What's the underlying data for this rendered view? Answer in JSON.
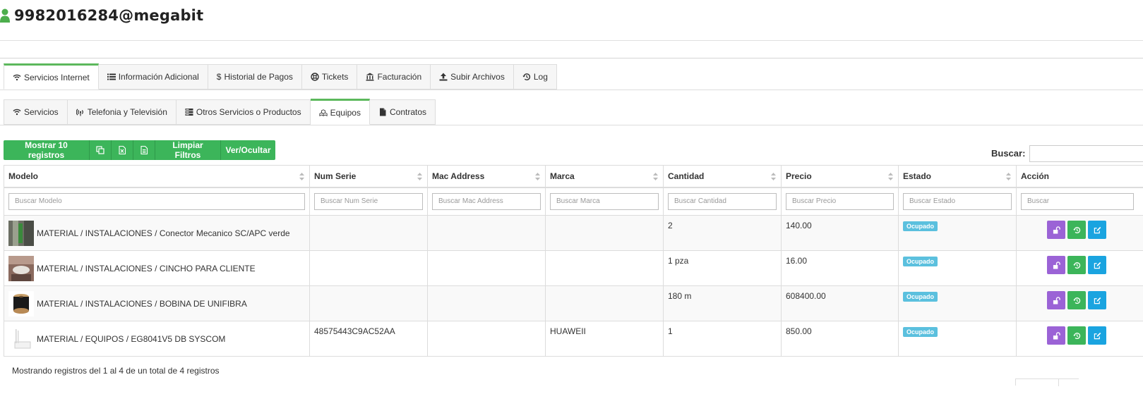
{
  "header": {
    "title": "9982016284@megabit"
  },
  "main_tabs": [
    {
      "label": "Servicios Internet",
      "icon": "wifi-icon",
      "active": true
    },
    {
      "label": "Información Adicional",
      "icon": "list-icon"
    },
    {
      "label": "Historial de Pagos",
      "icon": "dollar-icon"
    },
    {
      "label": "Tickets",
      "icon": "lifebuoy-icon"
    },
    {
      "label": "Facturación",
      "icon": "bank-icon"
    },
    {
      "label": "Subir Archivos",
      "icon": "upload-icon"
    },
    {
      "label": "Log",
      "icon": "history-icon"
    }
  ],
  "sub_tabs": [
    {
      "label": "Servicios",
      "icon": "wifi-icon"
    },
    {
      "label": "Telefonia y Televisión",
      "icon": "broadcast-icon"
    },
    {
      "label": "Otros Servicios o Productos",
      "icon": "server-icon"
    },
    {
      "label": "Equipos",
      "icon": "cubes-icon",
      "active": true
    },
    {
      "label": "Contratos",
      "icon": "file-icon"
    }
  ],
  "toolbar": {
    "show_label": "Mostrar 10 registros",
    "clear_filters_label": "Limpiar Filtros",
    "toggle_columns_label": "Ver/Ocultar"
  },
  "search": {
    "label": "Buscar:",
    "value": ""
  },
  "table": {
    "columns": [
      "Modelo",
      "Num Serie",
      "Mac Address",
      "Marca",
      "Cantidad",
      "Precio",
      "Estado",
      "Acción"
    ],
    "filter_placeholders": [
      "Buscar Modelo",
      "Buscar Num Serie",
      "Buscar Mac Address",
      "Buscar Marca",
      "Buscar Cantidad",
      "Buscar Precio",
      "Buscar Estado",
      "Buscar"
    ],
    "rows": [
      {
        "modelo": "MATERIAL / INSTALACIONES / Conector Mecanico SC/APC verde",
        "num_serie": "",
        "mac": "",
        "marca": "",
        "cantidad": "2",
        "precio": "140.00",
        "estado": "Ocupado"
      },
      {
        "modelo": "MATERIAL / INSTALACIONES / CINCHO PARA CLIENTE",
        "num_serie": "",
        "mac": "",
        "marca": "",
        "cantidad": "1 pza",
        "precio": "16.00",
        "estado": "Ocupado"
      },
      {
        "modelo": "MATERIAL / INSTALACIONES / BOBINA DE UNIFIBRA",
        "num_serie": "",
        "mac": "",
        "marca": "",
        "cantidad": "180 m",
        "precio": "608400.00",
        "estado": "Ocupado"
      },
      {
        "modelo": "MATERIAL / EQUIPOS / EG8041V5 DB SYSCOM",
        "num_serie": "48575443C9AC52AA",
        "mac": "",
        "marca": "HUAWEII",
        "cantidad": "1",
        "precio": "850.00",
        "estado": "Ocupado"
      }
    ]
  },
  "footer": {
    "info": "Mostrando registros del 1 al 4 de un total de 4 registros"
  },
  "colors": {
    "accent_green": "#3cb55a",
    "badge_blue": "#5bc0de",
    "action_purple": "#9b63d6",
    "action_blue": "#1aa4e0"
  }
}
